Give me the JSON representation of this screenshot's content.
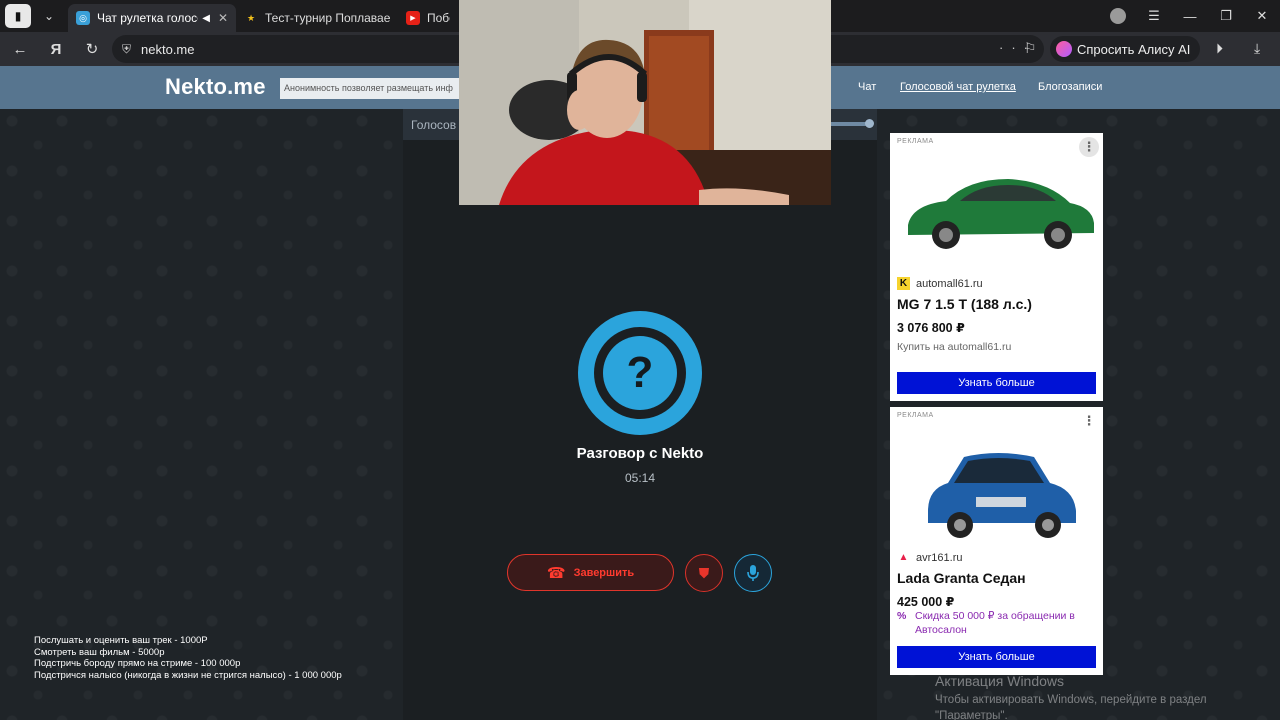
{
  "browser": {
    "tabs": [
      {
        "title": "Чат рулетка голосо",
        "active": true
      },
      {
        "title": "Тест-турнир Поплаваешь",
        "active": false
      },
      {
        "title": "Побо",
        "active": false
      }
    ],
    "url": "nekto.me",
    "alice_label": "Спросить Алису AI"
  },
  "site": {
    "logo": "Nekto.me",
    "anon_notice": "Анонимность позволяет размещать инф",
    "nav": [
      "Чат",
      "Голосовой чат рулетка",
      "Блогозаписи"
    ]
  },
  "panel": {
    "header_label": "Голосов",
    "conversation_title": "Разговор с Nekto",
    "timer": "05:14",
    "end_button": "Завершить"
  },
  "ads": [
    {
      "tag": "РЕКЛАМА",
      "domain": "automall61.ru",
      "title": "MG 7 1.5 T (188 л.с.)",
      "price": "3 076 800 ₽",
      "subtitle": "Купить на automall61.ru",
      "cta": "Узнать больше",
      "car_color": "#1f7a3a"
    },
    {
      "tag": "РЕКЛАМА",
      "domain": "avr161.ru",
      "title": "Lada Granta Седан",
      "price": "425 000 ₽",
      "promo_icon": "%",
      "promo": "Скидка 50 000 ₽ за обращении в Автосалон",
      "cta": "Узнать больше",
      "car_color": "#1f5fa8"
    }
  ],
  "price_list": [
    "Послушать и оценить ваш трек - 1000Р",
    "Смотреть ваш фильм - 5000р",
    "Подстричь бороду прямо на стриме - 100 000р",
    "Подстричся налысо (никогда в жизни не стригся налысо) - 1 000 000р"
  ],
  "watermark": {
    "line1": "Активация Windows",
    "line2": "Чтобы активировать Windows, перейдите в раздел",
    "line3": "\"Параметры\"."
  },
  "colors": {
    "accent_blue": "#2ba4dc",
    "danger_red": "#e0352b",
    "header_bg": "#57758f",
    "ad_cta": "#0012d6"
  }
}
